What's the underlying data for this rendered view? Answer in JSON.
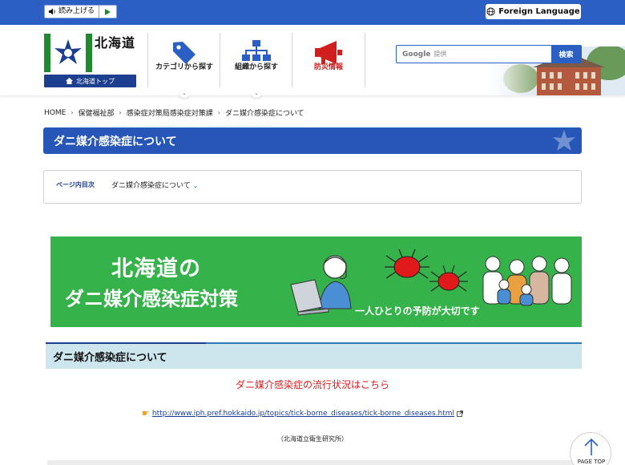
{
  "topbar": {
    "read_aloud_label": "読み上げる",
    "foreign_language_label": "Foreign Language"
  },
  "header": {
    "logo_title": "北海道",
    "logo_top_label": "北海道トップ",
    "nav": [
      {
        "label": "カテゴリから探す",
        "icon": "tag-icon"
      },
      {
        "label": "組織から探す",
        "icon": "org-chart-icon"
      },
      {
        "label": "防災情報",
        "icon": "megaphone-icon"
      }
    ],
    "search": {
      "google_label": "Google",
      "placeholder": "提供",
      "button_label": "検索"
    }
  },
  "breadcrumb": [
    "HOME",
    "保健福祉部",
    "感染症対策局感染症対策課",
    "ダニ媒介感染症について"
  ],
  "page_title": "ダニ媒介感染症について",
  "toc": {
    "label": "ページ内目次",
    "link": "ダニ媒介感染症について"
  },
  "banner": {
    "line1": "北海道の",
    "line2": "ダニ媒介感染症対策",
    "tagline": "一人ひとりの予防が大切です"
  },
  "section": {
    "heading": "ダニ媒介感染症について",
    "trend_text": "ダニ媒介感染症の流行状況はこちら",
    "url": "http://www.iph.pref.hokkaido.jp/topics/tick-borne_diseases/tick-borne_diseases.html",
    "source": "（北海道立衛生研究所）"
  },
  "page_top_label": "PAGE TOP",
  "colors": {
    "brand_blue": "#2b5fc4",
    "title_blue": "#2556b8",
    "banner_green": "#36b24a",
    "alert_red": "#e01a1a"
  }
}
